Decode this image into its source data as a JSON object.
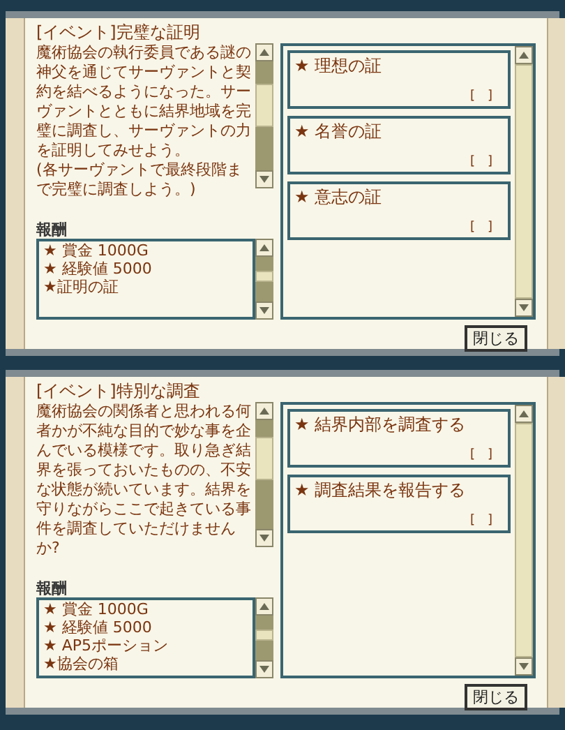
{
  "quests": [
    {
      "title": "[イベント]完璧な証明",
      "description": [
        "魔術協会の執行委員である謎の神父を通じてサーヴァントと契約を結べるようになった。サーヴァントとともに結界地域を完璧に調査し、サーヴァントの力を証明してみせよう。",
        "(各サーヴァントで最終段階まで完璧に調査しよう。)"
      ],
      "rewards_label": "報酬",
      "rewards": [
        "★ 賞金 1000G",
        "★ 経験値 5000",
        "★証明の証"
      ],
      "objectives": [
        {
          "label": "★ 理想の証",
          "progress": "[　]"
        },
        {
          "label": "★ 名誉の証",
          "progress": "[　]"
        },
        {
          "label": "★ 意志の証",
          "progress": "[　]"
        }
      ],
      "close": "閉じる"
    },
    {
      "title": "[イベント]特別な調査",
      "description": [
        "魔術協会の関係者と思われる何者かが不純な目的で妙な事を企んでいる模様です。取り急ぎ結界を張っておいたものの、不安な状態が続いています。結界を守りながらここで起きている事件を調査していただけませんか?"
      ],
      "rewards_label": "報酬",
      "rewards": [
        "★ 賞金 1000G",
        "★ 経験値 5000",
        "★ AP5ポーション",
        "★協会の箱"
      ],
      "objectives": [
        {
          "label": "★ 結界内部を調査する",
          "progress": "[　]"
        },
        {
          "label": "★ 調査結果を報告する",
          "progress": "[　]"
        }
      ],
      "close": "閉じる"
    }
  ]
}
